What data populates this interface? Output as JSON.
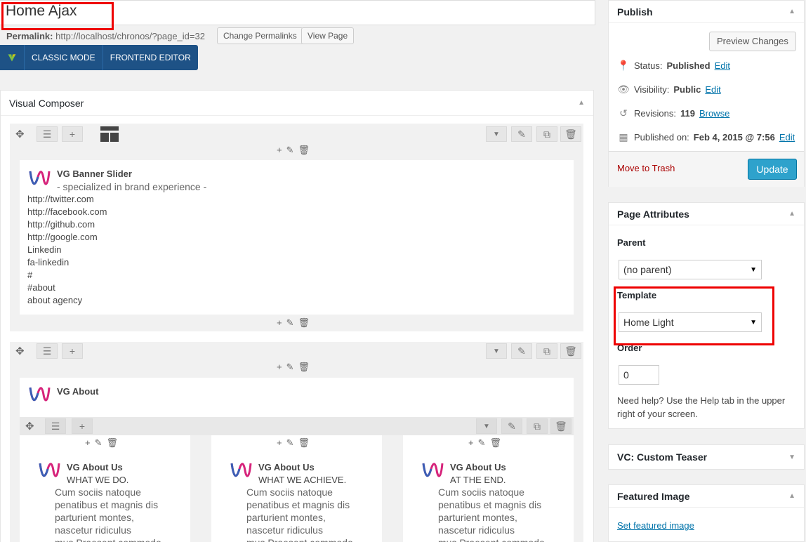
{
  "title": {
    "value": "Home Ajax"
  },
  "permalink": {
    "label": "Permalink:",
    "url": "http://localhost/chronos/?page_id=32",
    "change_label": "Change Permalinks",
    "view_label": "View Page"
  },
  "vc_toolbar": {
    "classic_label": "CLASSIC MODE",
    "frontend_label": "FRONTEND EDITOR"
  },
  "visual_composer": {
    "title": "Visual Composer",
    "banner": {
      "name": "VG Banner Slider",
      "subtitle": "- specialized in brand experience -",
      "lines": [
        "http://twitter.com",
        "http://facebook.com",
        "http://github.com",
        "http://google.com",
        "Linkedin",
        "fa-linkedin",
        "#",
        "#about",
        "about agency"
      ]
    },
    "about": {
      "name": "VG About",
      "columns": [
        {
          "name": "VG About Us",
          "heading": "WHAT WE DO.",
          "text": [
            "Cum sociis natoque",
            "penatibus et magnis dis",
            "parturient montes,",
            "nascetur ridiculus",
            "mus.Praesent commodo"
          ]
        },
        {
          "name": "VG About Us",
          "heading": "WHAT WE ACHIEVE.",
          "text": [
            "Cum sociis natoque",
            "penatibus et magnis dis",
            "parturient montes,",
            "nascetur ridiculus",
            "mus.Praesent commodo"
          ]
        },
        {
          "name": "VG About Us",
          "heading": "AT THE END.",
          "text": [
            "Cum sociis natoque",
            "penatibus et magnis dis",
            "parturient montes,",
            "nascetur ridiculus",
            "mus.Praesent commodo"
          ]
        }
      ]
    }
  },
  "publish": {
    "title": "Publish",
    "preview_label": "Preview Changes",
    "status_label": "Status:",
    "status_value": "Published",
    "status_edit": "Edit",
    "visibility_label": "Visibility:",
    "visibility_value": "Public",
    "visibility_edit": "Edit",
    "revisions_label": "Revisions:",
    "revisions_value": "119",
    "revisions_browse": "Browse",
    "published_label": "Published on:",
    "published_value": "Feb 4, 2015 @ 7:56",
    "published_edit": "Edit",
    "trash_label": "Move to Trash",
    "update_label": "Update"
  },
  "page_attributes": {
    "title": "Page Attributes",
    "parent_label": "Parent",
    "parent_value": "(no parent)",
    "template_label": "Template",
    "template_value": "Home Light",
    "order_label": "Order",
    "order_value": "0",
    "help_line1": "Need help? Use the Help tab in the upper",
    "help_line2": "right of your screen."
  },
  "custom_teaser": {
    "title": "VC: Custom Teaser"
  },
  "featured_image": {
    "title": "Featured Image",
    "link": "Set featured image"
  },
  "colors": {
    "accent": "#1e5286",
    "link": "#0073aa",
    "update": "#2ea2cc",
    "highlight": "#e00000",
    "trash": "#a00"
  }
}
